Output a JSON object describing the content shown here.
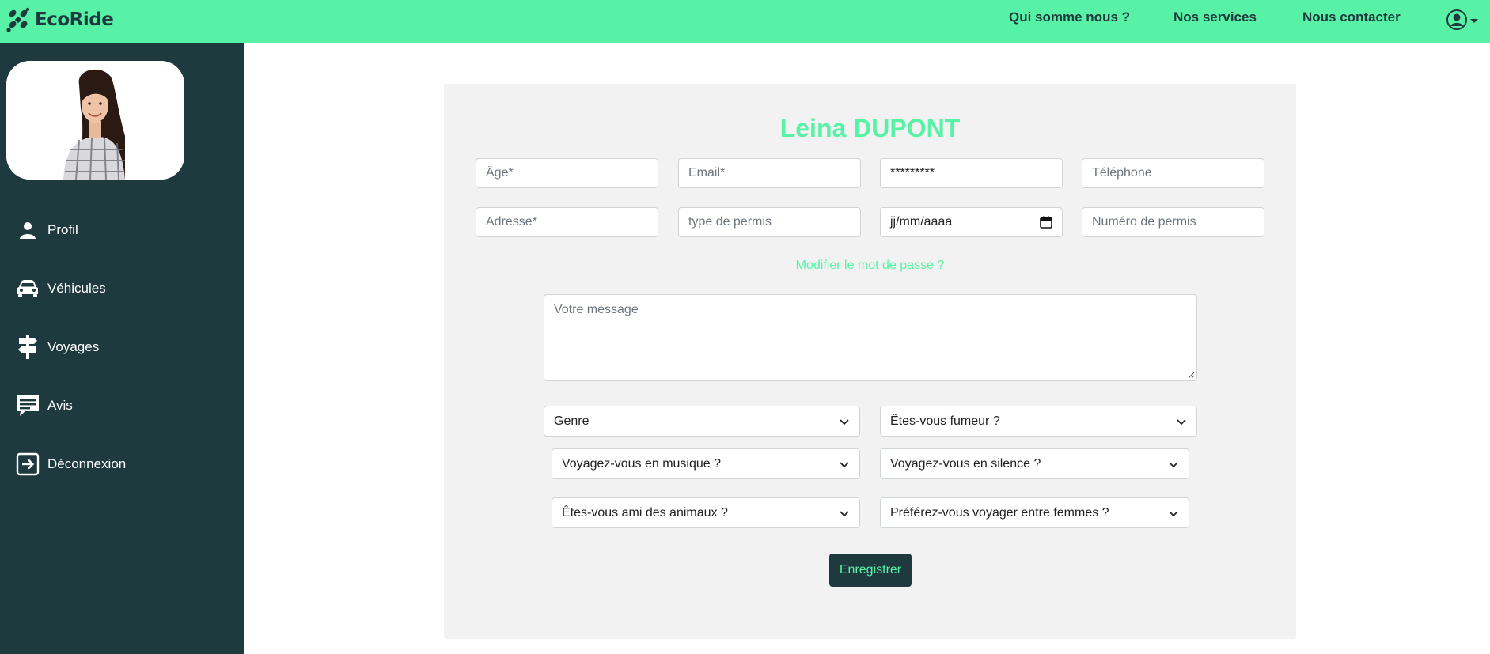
{
  "app": {
    "name": "EcoRide"
  },
  "nav": {
    "links": [
      {
        "label": "Qui somme nous ?"
      },
      {
        "label": "Nos services"
      },
      {
        "label": "Nous contacter"
      }
    ],
    "user_icon": "user-circle-icon"
  },
  "sidebar": {
    "avatar_icon": "profile-photo",
    "items": [
      {
        "label": "Profil",
        "icon": "person-icon"
      },
      {
        "label": "Véhicules",
        "icon": "car-icon"
      },
      {
        "label": "Voyages",
        "icon": "signpost-icon"
      },
      {
        "label": "Avis",
        "icon": "chat-icon"
      },
      {
        "label": "Déconnexion",
        "icon": "logout-icon"
      }
    ]
  },
  "form": {
    "title": "Leina DUPONT",
    "fields": {
      "age": {
        "placeholder": "Âge*"
      },
      "email": {
        "placeholder": "Email*"
      },
      "password": {
        "value": "*********"
      },
      "phone": {
        "placeholder": "Téléphone"
      },
      "address": {
        "placeholder": "Adresse*"
      },
      "license_type": {
        "placeholder": "type de permis"
      },
      "date": {
        "value": "jj/mm/aaaa"
      },
      "license_number": {
        "placeholder": "Numéro de permis"
      }
    },
    "change_password_link": "Modifier le mot de passe ?",
    "message": {
      "placeholder": "Votre message"
    },
    "selects": [
      {
        "label": "Genre"
      },
      {
        "label": "Êtes-vous fumeur ?"
      },
      {
        "label": "Voyagez-vous en musique ?"
      },
      {
        "label": "Voyagez-vous en silence ?"
      },
      {
        "label": "Êtes-vous ami des animaux ?"
      },
      {
        "label": "Préférez-vous voyager entre femmes ?"
      }
    ],
    "submit_label": "Enregistrer"
  },
  "colors": {
    "accent": "#58f2a6",
    "sidebar": "#1f3a3f",
    "card": "#f2f2f2"
  }
}
